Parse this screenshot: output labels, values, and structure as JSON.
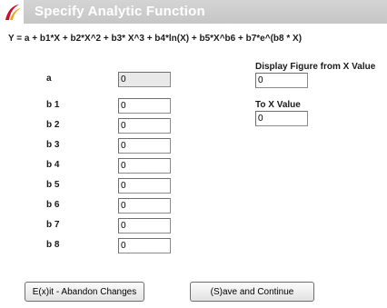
{
  "window": {
    "title": "Specify Analytic Function"
  },
  "formula": "Y = a + b1*X + b2*X^2 + b3* X^3 + b4*ln(X) + b5*X^b6 + b7*e^(b8 * X)",
  "parameters": [
    {
      "label": "a",
      "value": "0"
    },
    {
      "label": "b 1",
      "value": "0"
    },
    {
      "label": "b 2",
      "value": "0"
    },
    {
      "label": "b 3",
      "value": "0"
    },
    {
      "label": "b 4",
      "value": "0"
    },
    {
      "label": "b 5",
      "value": "0"
    },
    {
      "label": "b 6",
      "value": "0"
    },
    {
      "label": "b 7",
      "value": "0"
    },
    {
      "label": "b 8",
      "value": "0"
    }
  ],
  "range": {
    "from_label": "Display Figure from X Value",
    "from_value": "0",
    "to_label": "To X Value",
    "to_value": "0"
  },
  "buttons": {
    "exit": "E(x)it - Abandon Changes",
    "save": "(S)ave and Continue"
  },
  "colors": {
    "titlebar": "#c9c9c9",
    "logo_red": "#c8102e",
    "logo_gold": "#e6a817"
  }
}
